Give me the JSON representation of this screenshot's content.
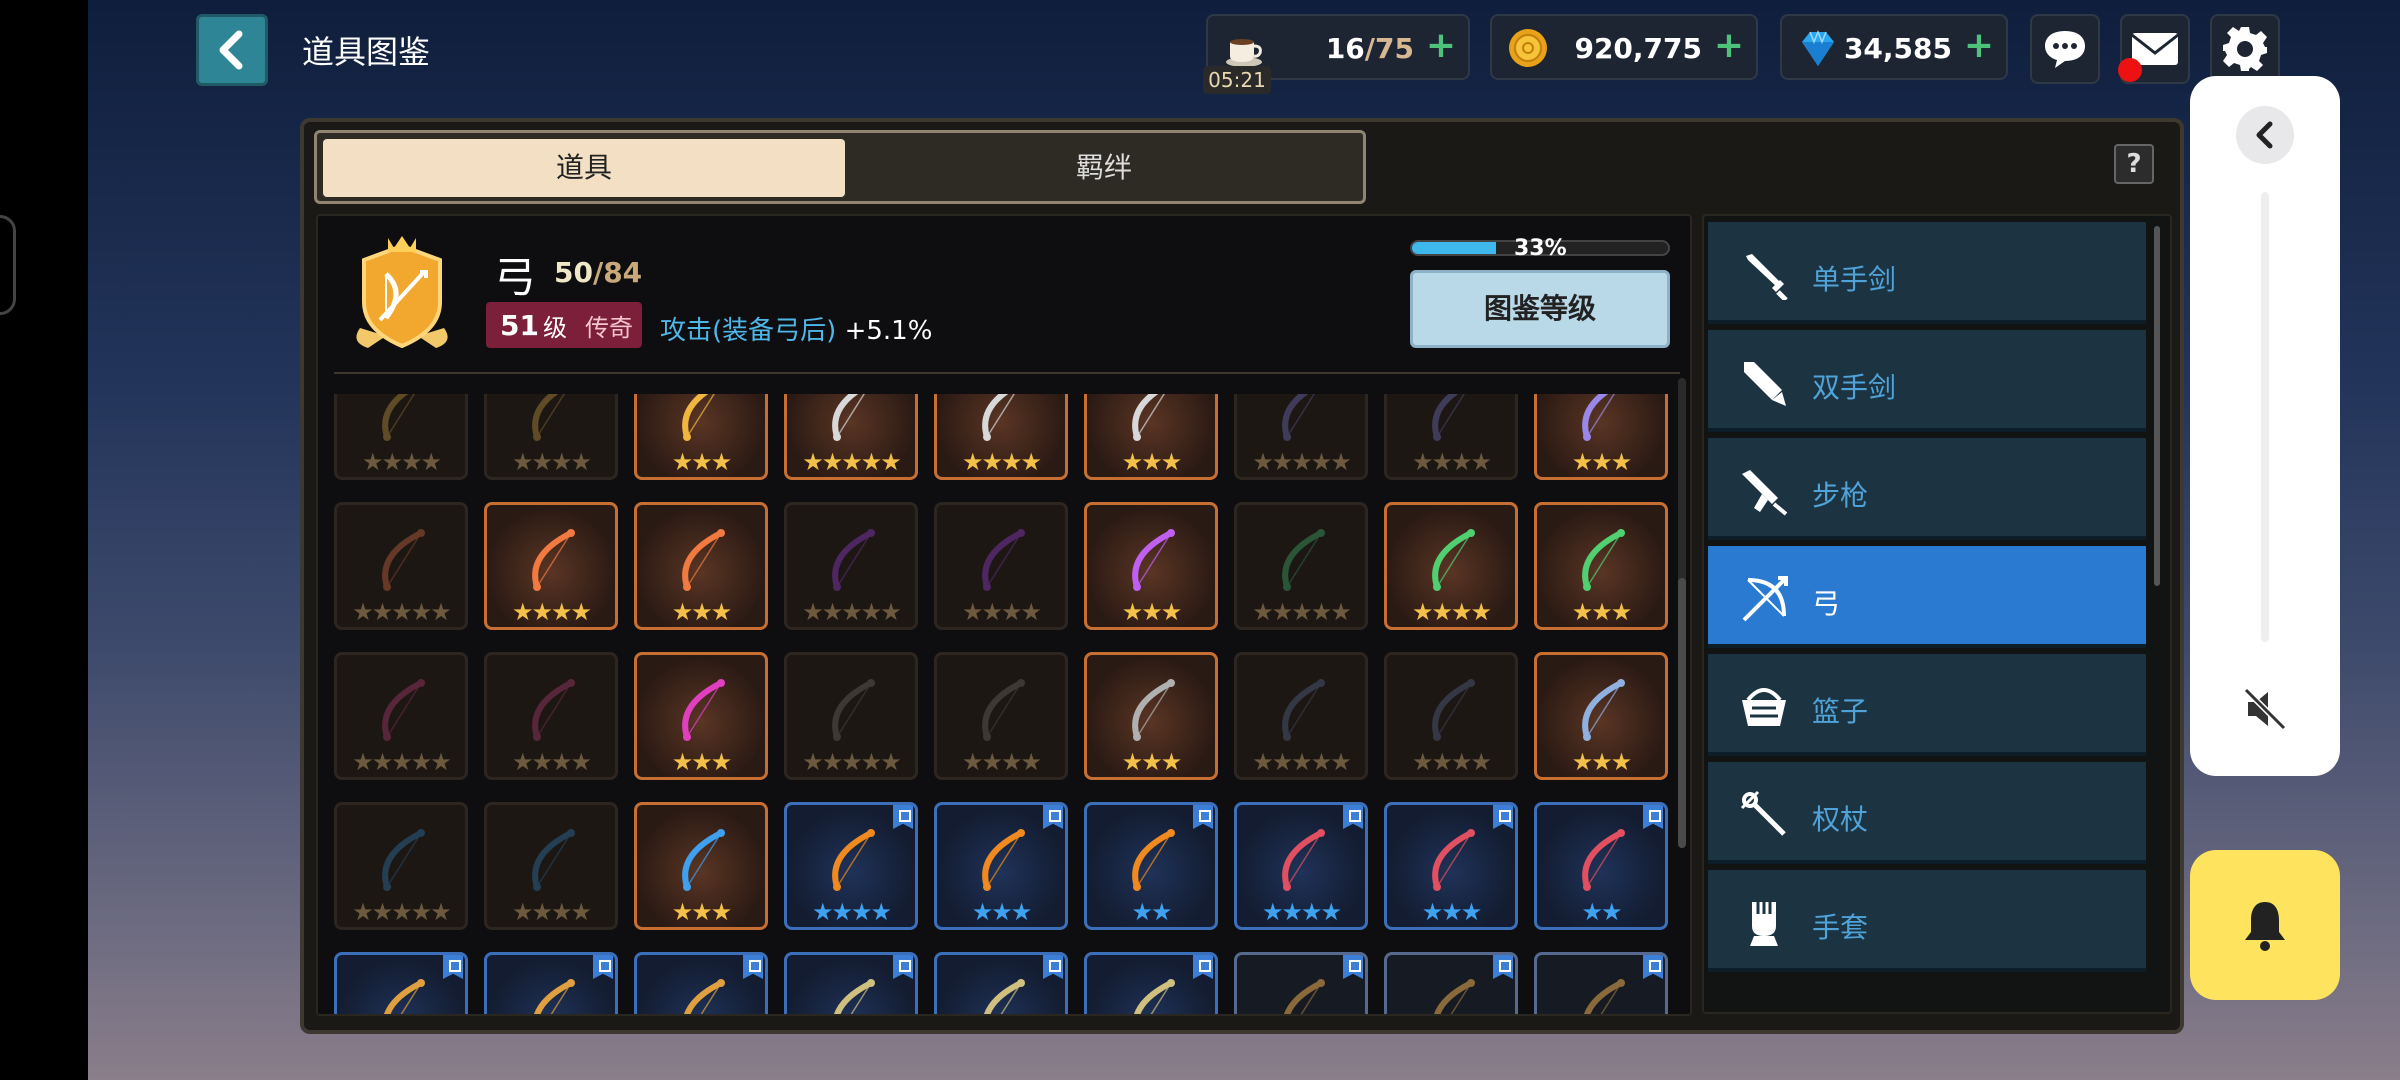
{
  "header": {
    "title": "道具图鉴",
    "stamina": {
      "current": "16",
      "sep_max": "/75",
      "timer": "05:21"
    },
    "gold": "920,775",
    "gems": "34,585",
    "plus": "+"
  },
  "tabs": {
    "items": "道具",
    "bonds": "羁绊"
  },
  "help": "?",
  "category": {
    "name": "弓",
    "collected": "50",
    "total": "/84",
    "level": "51",
    "level_word": "级",
    "tier": "传奇",
    "bonus_attr": "攻击(装备弓后)",
    "bonus_value": "+5.1%",
    "progress_text": "33%",
    "progress": 0.33,
    "codex_button": "图鉴等级"
  },
  "grid": [
    {
      "style": "dim",
      "stars": 4,
      "color": "#b08a3a"
    },
    {
      "style": "dim",
      "stars": 4,
      "color": "#b08a3a"
    },
    {
      "style": "owned",
      "stars": 3,
      "color": "#f0b640"
    },
    {
      "style": "owned",
      "stars": 5,
      "color": "#d8d8d8"
    },
    {
      "style": "owned",
      "stars": 4,
      "color": "#d8d8d8"
    },
    {
      "style": "owned",
      "stars": 3,
      "color": "#d8d8d8"
    },
    {
      "style": "dim",
      "stars": 5,
      "color": "#6a6ab0"
    },
    {
      "style": "dim",
      "stars": 4,
      "color": "#6a6ab0"
    },
    {
      "style": "owned",
      "stars": 3,
      "color": "#9a88e8"
    },
    {
      "style": "dim",
      "stars": 5,
      "color": "#c06040"
    },
    {
      "style": "owned",
      "stars": 4,
      "color": "#f07a40"
    },
    {
      "style": "owned",
      "stars": 3,
      "color": "#f07a40"
    },
    {
      "style": "dim",
      "stars": 5,
      "color": "#8a3ac0"
    },
    {
      "style": "dim",
      "stars": 4,
      "color": "#8a3ac0"
    },
    {
      "style": "owned",
      "stars": 3,
      "color": "#c060f0"
    },
    {
      "style": "dim",
      "stars": 5,
      "color": "#3aa060"
    },
    {
      "style": "owned",
      "stars": 4,
      "color": "#50d070"
    },
    {
      "style": "owned",
      "stars": 3,
      "color": "#50d070"
    },
    {
      "style": "dim",
      "stars": 5,
      "color": "#a03a6a"
    },
    {
      "style": "dim",
      "stars": 4,
      "color": "#a03a6a"
    },
    {
      "style": "owned",
      "stars": 3,
      "color": "#e040c0"
    },
    {
      "style": "dim",
      "stars": 5,
      "color": "#606060"
    },
    {
      "style": "dim",
      "stars": 4,
      "color": "#606060"
    },
    {
      "style": "owned",
      "stars": 3,
      "color": "#b0b0b0"
    },
    {
      "style": "dim",
      "stars": 5,
      "color": "#506080"
    },
    {
      "style": "dim",
      "stars": 4,
      "color": "#506080"
    },
    {
      "style": "owned",
      "stars": 3,
      "color": "#90b0e0"
    },
    {
      "style": "dim",
      "stars": 5,
      "color": "#3070a0"
    },
    {
      "style": "dim",
      "stars": 4,
      "color": "#3070a0"
    },
    {
      "style": "owned",
      "stars": 3,
      "color": "#40a0f0"
    },
    {
      "style": "blue",
      "stars": 4,
      "color": "#f08a20",
      "flag": true
    },
    {
      "style": "blue",
      "stars": 3,
      "color": "#f08a20",
      "flag": true
    },
    {
      "style": "blue",
      "stars": 2,
      "color": "#f08a20",
      "flag": true
    },
    {
      "style": "blue",
      "stars": 4,
      "color": "#e05060",
      "flag": true
    },
    {
      "style": "blue",
      "stars": 3,
      "color": "#e05060",
      "flag": true
    },
    {
      "style": "blue",
      "stars": 2,
      "color": "#e05060",
      "flag": true
    },
    {
      "style": "blue",
      "stars": 0,
      "color": "#e0a040",
      "flag": true
    },
    {
      "style": "blue",
      "stars": 0,
      "color": "#e0a040",
      "flag": true
    },
    {
      "style": "blue",
      "stars": 0,
      "color": "#e0a040",
      "flag": true
    },
    {
      "style": "blue",
      "stars": 0,
      "color": "#d0c080",
      "flag": true
    },
    {
      "style": "blue",
      "stars": 0,
      "color": "#d0c080",
      "flag": true
    },
    {
      "style": "blue",
      "stars": 0,
      "color": "#d0c080",
      "flag": true
    },
    {
      "style": "blue-dim",
      "stars": 0,
      "color": "#8a6a3a",
      "flag": true
    },
    {
      "style": "blue-dim",
      "stars": 0,
      "color": "#8a6a3a",
      "flag": true
    },
    {
      "style": "blue-dim",
      "stars": 0,
      "color": "#8a6a3a",
      "flag": true
    }
  ],
  "categories": [
    {
      "label": "单手剑",
      "icon": "sword-icon"
    },
    {
      "label": "双手剑",
      "icon": "greatsword-icon"
    },
    {
      "label": "步枪",
      "icon": "rifle-icon"
    },
    {
      "label": "弓",
      "icon": "bow-icon",
      "active": true
    },
    {
      "label": "篮子",
      "icon": "basket-icon"
    },
    {
      "label": "权杖",
      "icon": "staff-icon"
    },
    {
      "label": "手套",
      "icon": "gauntlet-icon"
    }
  ],
  "colors": {
    "accent": "#2a7ad2",
    "legendary": "#7b1f3a",
    "owned_border": "#c76f32",
    "star_gold": "#f3c04a",
    "star_blue": "#3fa2f0"
  }
}
